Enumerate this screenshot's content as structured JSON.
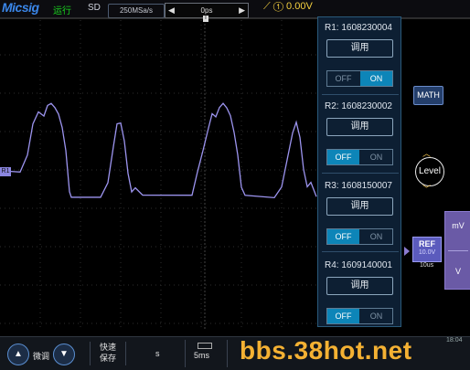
{
  "header": {
    "brand": "Micsig",
    "run_state": "运行",
    "mode": "SD",
    "sample_rate": "250MSa/s",
    "time_offset": "0ps",
    "trigger_level": "0.00V"
  },
  "ref_panel": {
    "items": [
      {
        "name": "R1: 1608230004",
        "recall_label": "调用",
        "off_label": "OFF",
        "on_label": "ON",
        "state": "on"
      },
      {
        "name": "R2: 1608230002",
        "recall_label": "调用",
        "off_label": "OFF",
        "on_label": "ON",
        "state": "off"
      },
      {
        "name": "R3: 1608150007",
        "recall_label": "调用",
        "off_label": "OFF",
        "on_label": "ON",
        "state": "off"
      },
      {
        "name": "R4: 1609140001",
        "recall_label": "调用",
        "off_label": "OFF",
        "on_label": "ON",
        "state": "off"
      }
    ]
  },
  "side": {
    "math_label": "MATH",
    "level_label": "Level",
    "ref_label": "REF",
    "ref_scale": "10.0V",
    "ref_timebase": "10us",
    "unit_mv": "mV",
    "unit_v": "V"
  },
  "channel": {
    "tag": "R1"
  },
  "bottom": {
    "fine_label": "微调",
    "save_line1": "快速",
    "save_line2": "保存",
    "unit_s": "s",
    "timebase": "5ms",
    "clock": "18:04"
  },
  "watermark": "bbs.38hot.net",
  "colors": {
    "waveform": "#9c94ef",
    "panel_bg": "#0d1f33",
    "toggle_active": "#0d85b8"
  }
}
